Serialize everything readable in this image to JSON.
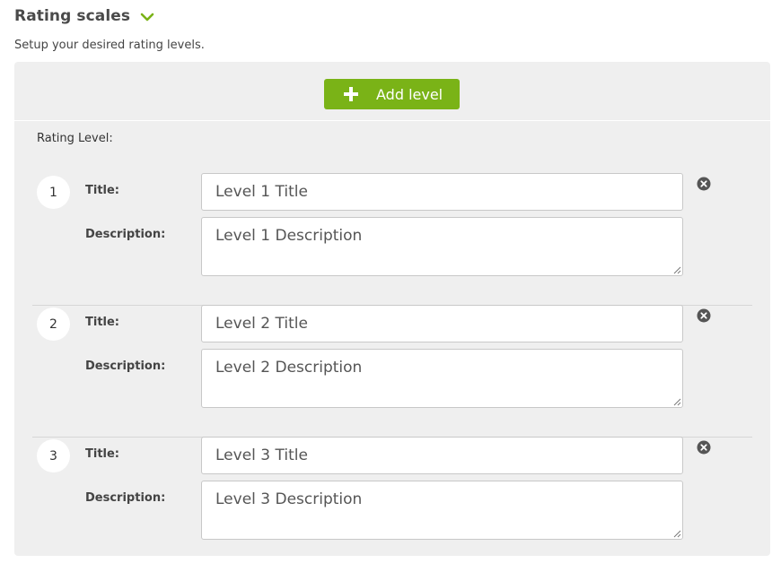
{
  "header": {
    "title": "Rating scales",
    "subtitle": "Setup your desired rating levels."
  },
  "toolbar": {
    "add_label": "Add level"
  },
  "rating": {
    "label": "Rating Level:",
    "title_label": "Title:",
    "description_label": "Description:",
    "levels": [
      {
        "number": "1",
        "title": "Level 1 Title",
        "description": "Level 1 Description"
      },
      {
        "number": "2",
        "title": "Level 2 Title",
        "description": "Level 2 Description"
      },
      {
        "number": "3",
        "title": "Level 3 Title",
        "description": "Level 3 Description"
      }
    ]
  },
  "colors": {
    "accent": "#7ab317",
    "panel": "#efefef",
    "close": "#555555"
  }
}
